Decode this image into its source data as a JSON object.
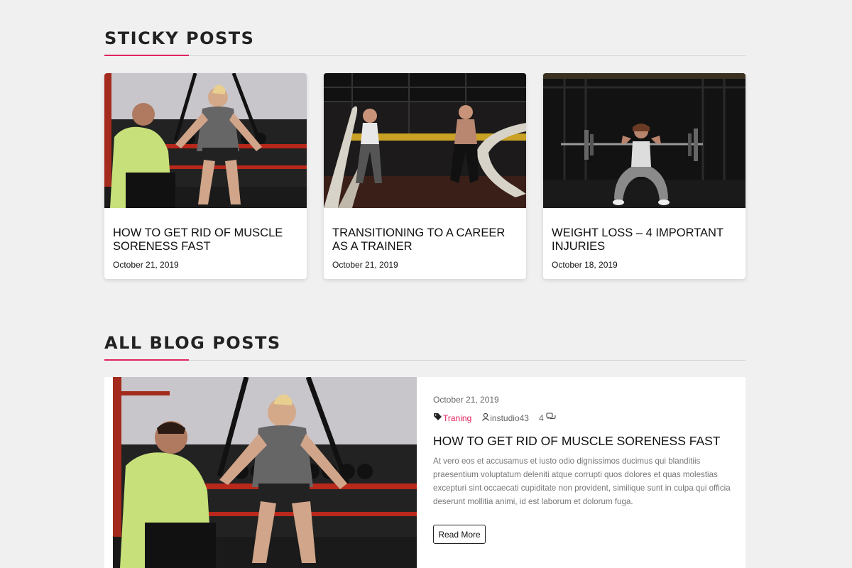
{
  "sticky": {
    "heading": "STICKY POSTS",
    "posts": [
      {
        "title": "How to get rid of muscle soreness fast",
        "date": "October 21, 2019"
      },
      {
        "title": "Transitioning to a Career as a Trainer",
        "date": "October 21, 2019"
      },
      {
        "title": "Weight loss – 4 important injuries",
        "date": "October 18, 2019"
      }
    ]
  },
  "blog": {
    "heading": "ALL BLOG POSTS",
    "posts": [
      {
        "date": "October 21, 2019",
        "category": "Traning",
        "author": "instudio43",
        "comments": "4",
        "title": "How to get rid of muscle soreness fast",
        "excerpt": "At vero eos et accusamus et iusto odio dignissimos ducimus qui blanditiis praesentium voluptatum deleniti atque corrupti quos dolores et quas molestias excepturi sint occaecati cupiditate non provident, similique sunt in culpa qui officia deserunt mollitia animi, id est laborum et dolorum fuga.",
        "read_more": "Read More"
      }
    ]
  },
  "icons": {
    "category": "tags-icon",
    "author": "user-icon",
    "comments": "comments-icon"
  },
  "colors": {
    "accent": "#e0245e",
    "background": "#f0f0f0"
  }
}
